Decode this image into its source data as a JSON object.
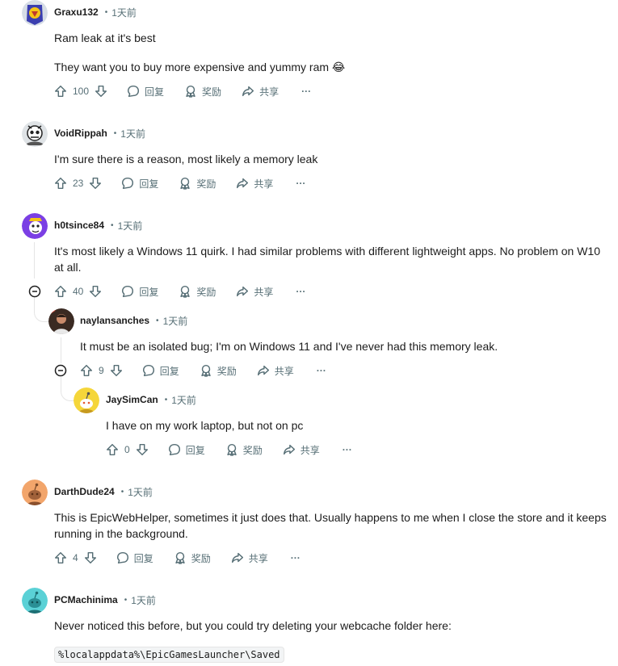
{
  "comments": [
    {
      "author": "Graxu132",
      "time": "1天前",
      "body": [
        "Ram leak at it's best",
        "They want you to buy more expensive and yummy ram 😂"
      ],
      "score": "100",
      "reply_label": "回复",
      "award_label": "奖励",
      "share_label": "共享",
      "more_label": "···"
    },
    {
      "author": "VoidRippah",
      "time": "1天前",
      "body": [
        "I'm sure there is a reason, most likely a memory leak"
      ],
      "score": "23",
      "reply_label": "回复",
      "award_label": "奖励",
      "share_label": "共享",
      "more_label": "···"
    },
    {
      "author": "h0tsince84",
      "time": "1天前",
      "body": [
        "It's most likely a Windows 11 quirk. I had similar problems with different lightweight apps. No problem on W10 at all."
      ],
      "score": "40",
      "reply_label": "回复",
      "award_label": "奖励",
      "share_label": "共享",
      "more_label": "···"
    },
    {
      "author": "naylansanches",
      "time": "1天前",
      "body": [
        "It must be an isolated bug; I'm on Windows 11 and I've never had this memory leak."
      ],
      "score": "9",
      "reply_label": "回复",
      "award_label": "奖励",
      "share_label": "共享",
      "more_label": "···"
    },
    {
      "author": "JaySimCan",
      "time": "1天前",
      "body": [
        "I have on my work laptop, but not on pc"
      ],
      "score": "0",
      "reply_label": "回复",
      "award_label": "奖励",
      "share_label": "共享",
      "more_label": "···"
    },
    {
      "author": "DarthDude24",
      "time": "1天前",
      "body": [
        "This is EpicWebHelper, sometimes it just does that. Usually happens to me when I close the store and it keeps running in the background."
      ],
      "score": "4",
      "reply_label": "回复",
      "award_label": "奖励",
      "share_label": "共享",
      "more_label": "···"
    },
    {
      "author": "PCMachinima",
      "time": "1天前",
      "body": [
        "Never noticed this before, but you could try deleting your webcache folder here:"
      ],
      "code": "%localappdata%\\EpicGamesLauncher\\Saved"
    }
  ],
  "icons": {
    "upvote": "upvote-arrow-icon",
    "downvote": "downvote-arrow-icon",
    "reply": "speech-bubble-icon",
    "award": "award-ribbon-icon",
    "share": "share-arrow-icon",
    "collapse": "minus-circle-icon"
  },
  "colors": {
    "text": "#1c1c1c",
    "meta": "#576f76",
    "thread": "#e5e5e5",
    "code_bg": "#f2f4f5"
  }
}
